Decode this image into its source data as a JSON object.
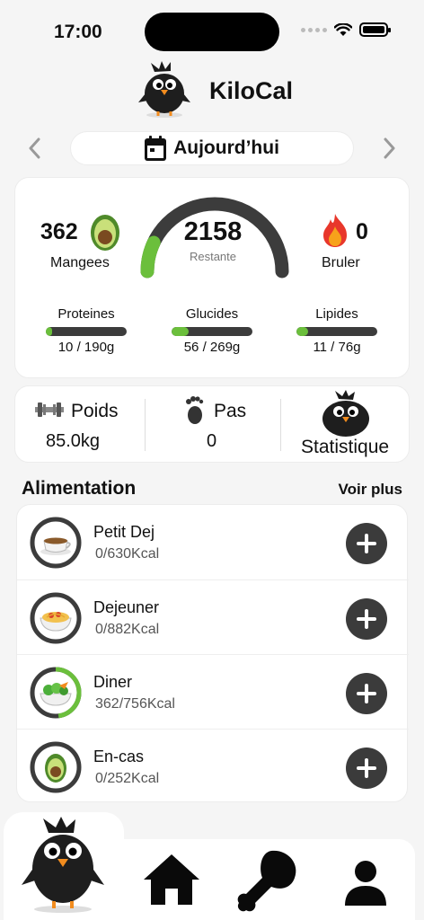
{
  "status_bar": {
    "time": "17:00"
  },
  "header": {
    "title": "KiloCal",
    "logo_icon": "crow-mascot-icon"
  },
  "date_nav": {
    "label": "Aujourd’hui",
    "icon": "calendar-icon"
  },
  "summary": {
    "eaten_value": "362",
    "eaten_label": "Mangees",
    "remaining_value": "2158",
    "remaining_label": "Restante",
    "remaining_fraction": 0.14,
    "burned_value": "0",
    "burned_label": "Bruler",
    "macros": [
      {
        "name": "Proteines",
        "value": "10 / 190g",
        "fraction": 0.05
      },
      {
        "name": "Glucides",
        "value": "56 / 269g",
        "fraction": 0.21
      },
      {
        "name": "Lipides",
        "value": "11 / 76g",
        "fraction": 0.14
      }
    ]
  },
  "stats": {
    "weight_label": "Poids",
    "weight_value": "85.0kg",
    "steps_label": "Pas",
    "steps_value": "0",
    "statistics_label": "Statistique"
  },
  "food_section": {
    "title": "Alimentation",
    "more_label": "Voir plus"
  },
  "meals": [
    {
      "name": "Petit Dej",
      "kcal": "0/630Kcal",
      "progress": 0.0,
      "icon": "coffee-cup-icon"
    },
    {
      "name": "Dejeuner",
      "kcal": "0/882Kcal",
      "progress": 0.0,
      "icon": "pasta-bowl-icon"
    },
    {
      "name": "Diner",
      "kcal": "362/756Kcal",
      "progress": 0.48,
      "icon": "salad-bowl-icon"
    },
    {
      "name": "En-cas",
      "kcal": "0/252Kcal",
      "progress": 0.0,
      "icon": "avocado-icon"
    }
  ],
  "colors": {
    "accent_green": "#6bbf3c",
    "dark": "#3b3b3b"
  }
}
